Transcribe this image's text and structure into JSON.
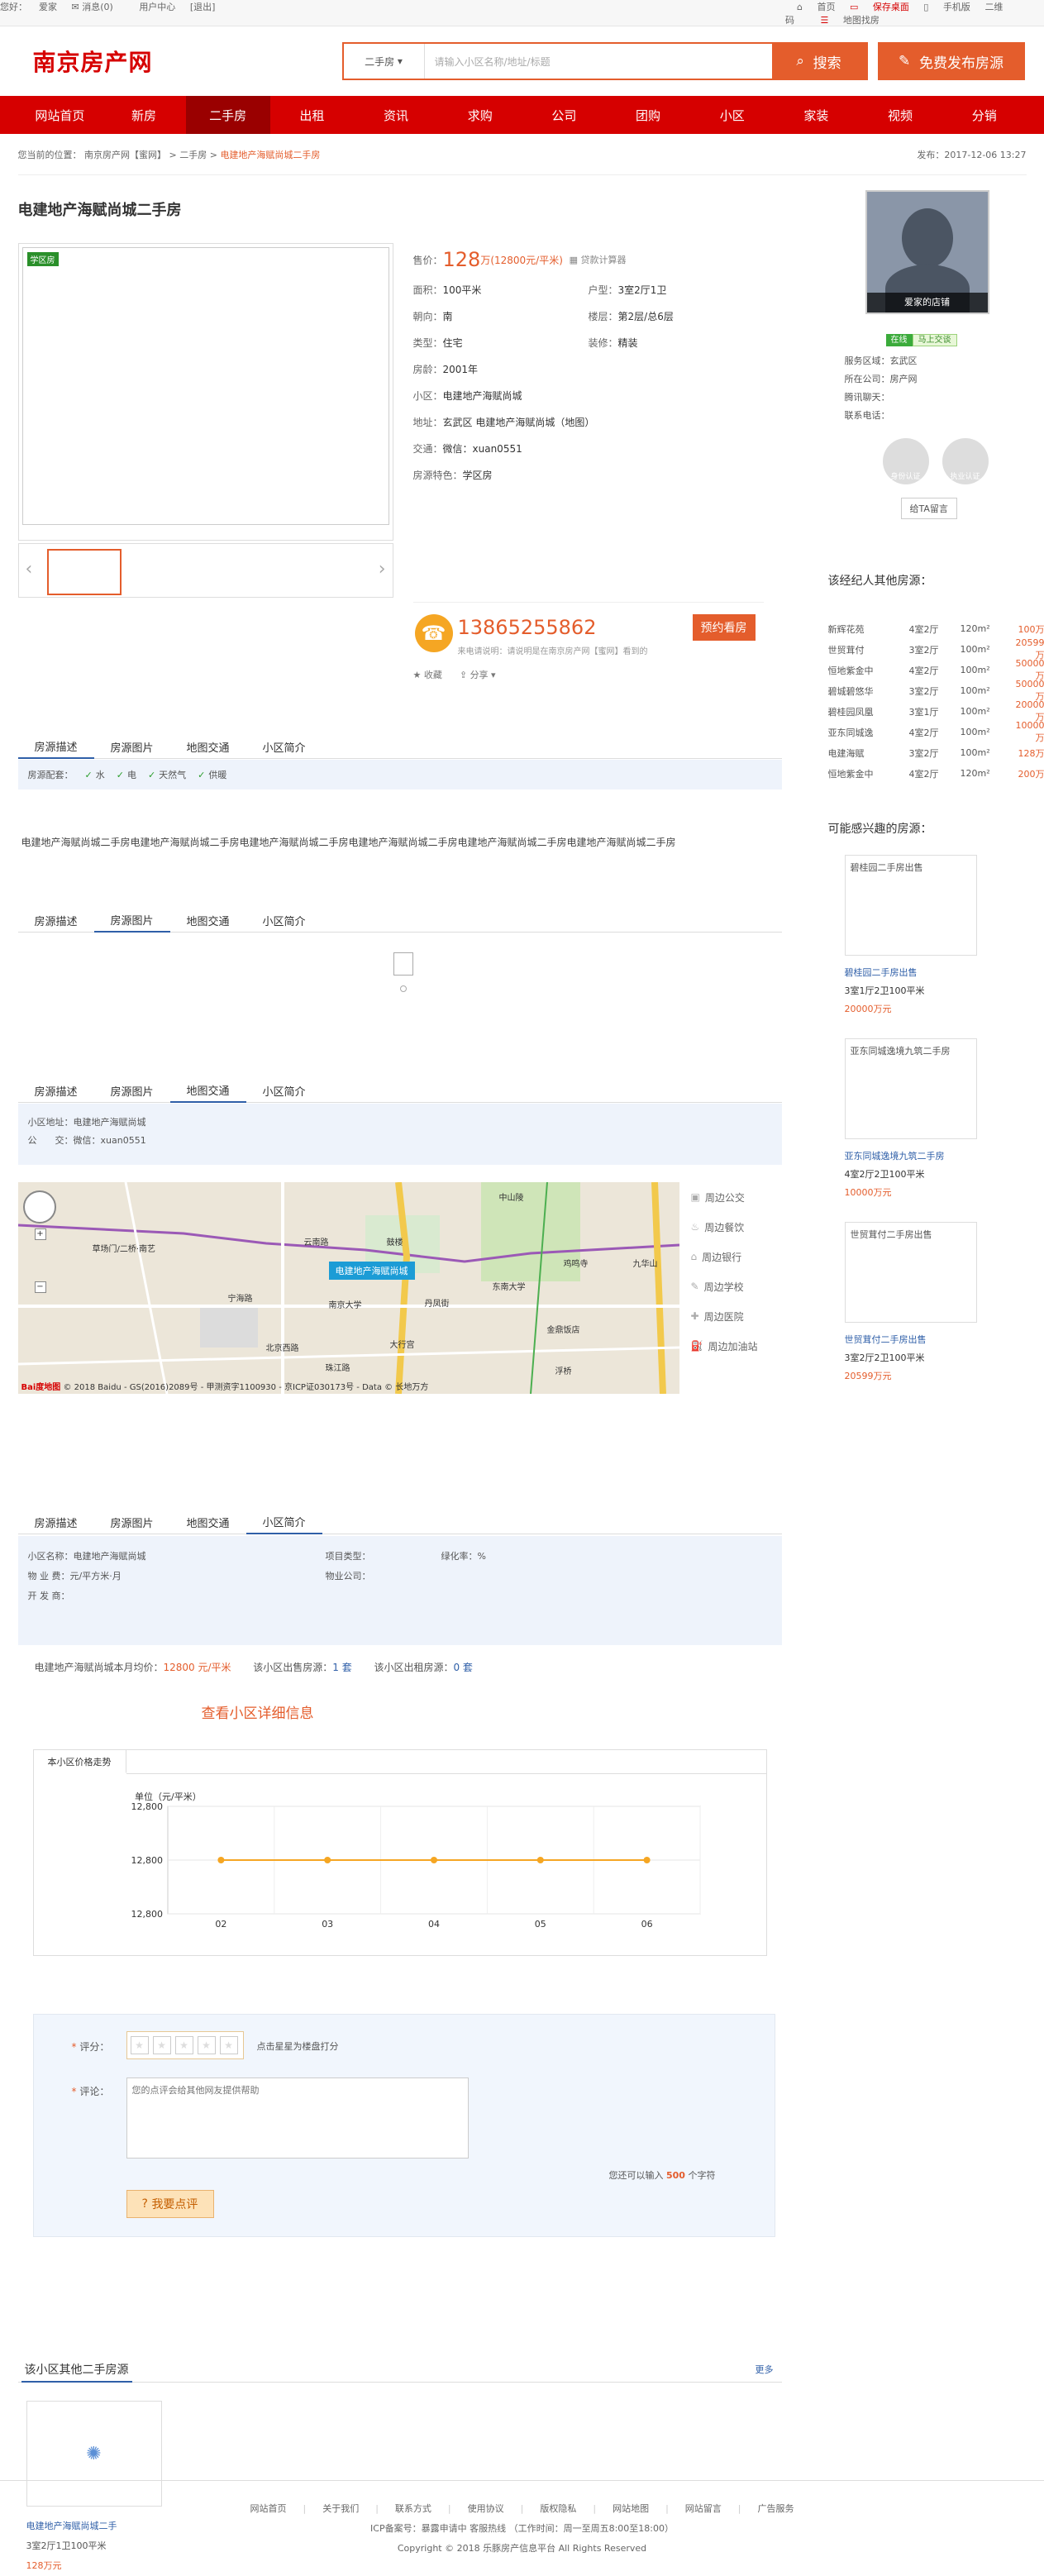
{
  "topbar": {
    "greeting": "您好：",
    "user": "爱家",
    "messages": "消息(0)",
    "user_center": "用户中心",
    "logout": "[退出]",
    "home": "首页",
    "save_desktop": "保存桌面",
    "mobile": "手机版",
    "qrcode": "二维码",
    "map_find": "地图找房"
  },
  "header": {
    "logo": "南京房产网",
    "search_select": "二手房",
    "search_placeholder": "请输入小区名称/地址/标题",
    "search_btn": "搜索",
    "publish_btn": "免费发布房源"
  },
  "nav": [
    "网站首页",
    "新房",
    "二手房",
    "出租",
    "资讯",
    "求购",
    "公司",
    "团购",
    "小区",
    "家装",
    "视频",
    "分销"
  ],
  "nav_active": 2,
  "crumb": {
    "prefix": "您当前的位置：",
    "site": "南京房产网【蜜网】",
    "sec": "二手房",
    "cur": "电建地产海赋尚城二手房",
    "date": "发布：2017-12-06 13:27"
  },
  "listing": {
    "title": "电建地产海赋尚城二手房",
    "tag": "学区房",
    "price_label": "售价：",
    "price": "128",
    "price_unit": "万(12800元/平米)",
    "calc": "贷款计算器",
    "area_k": "面积：",
    "area": "100平米",
    "type_k": "户型：",
    "type": "3室2厅1卫",
    "orient_k": "朝向：",
    "orient": "南",
    "floor_k": "楼层：",
    "floor": "第2层/总6层",
    "kind_k": "类型：",
    "kind": "住宅",
    "decor_k": "装修：",
    "decor": "精装",
    "age_k": "房龄：",
    "age": "2001年",
    "comm_k": "小区：",
    "comm": "电建地产海赋尚城",
    "addr_k": "地址：",
    "addr": "玄武区 电建地产海赋尚城（地图）",
    "traffic_k": "交通：",
    "traffic": "微信：xuan0551",
    "feat_k": "房源特色：",
    "feat": "学区房",
    "phone": "13865255862",
    "book": "预约看房",
    "phone_note": "来电请说明：请说明是在南京房产网【蜜网】看到的",
    "fav": "收藏",
    "share": "分享"
  },
  "tabs": [
    "房源描述",
    "房源图片",
    "地图交通",
    "小区简介"
  ],
  "features": {
    "label": "房源配套：",
    "items": [
      "水",
      "电",
      "天然气",
      "供暖"
    ]
  },
  "desc_text": "电建地产海赋尚城二手房电建地产海赋尚城二手房电建地产海赋尚城二手房电建地产海赋尚城二手房电建地产海赋尚城二手房电建地产海赋尚城二手房",
  "map_info": {
    "addr": "小区地址：电建地产海赋尚城",
    "traffic": "公　　交：微信：xuan0551"
  },
  "map": {
    "labels": [
      "南京大学",
      "珠江路",
      "鼓楼",
      "云南路",
      "鸡鸣寺",
      "九华山",
      "东南大学",
      "丹凤街",
      "宁海路",
      "草场门/二桥·南艺",
      "浮桥",
      "金鼎饭店",
      "中山陵",
      "北京西路",
      "大行宫"
    ],
    "pin": "电建地产海赋尚城",
    "copyright": "© 2018 Baidu - GS(2016)2089号 - 甲测资字1100930 - 京ICP证030173号 - Data © 长地万方",
    "baidu": "Bai度地图"
  },
  "map_tools": [
    "周边公交",
    "周边餐饮",
    "周边银行",
    "周边学校",
    "周边医院",
    "周边加油站"
  ],
  "community": {
    "name_k": "小区名称：",
    "name": "电建地产海赋尚城",
    "type_k": "项目类型：",
    "type": "",
    "green_k": "绿化率：",
    "green": "%",
    "fee_k": "物 业 费：",
    "fee": "元/平方米·月",
    "company_k": "物业公司：",
    "company": "",
    "dev_k": "开 发 商：",
    "dev": ""
  },
  "avg": {
    "t1": "电建地产海赋尚城本月均价：",
    "v1": "12800 元/平米",
    "t2": "该小区出售房源：",
    "v2": "1 套",
    "t3": "该小区出租房源：",
    "v3": "0 套"
  },
  "more_info": "查看小区详细信息",
  "chart_title": "本小区价格走势",
  "chart_data": {
    "type": "line",
    "title": "",
    "ylabel": "单位（元/平米）",
    "x": [
      "02",
      "03",
      "04",
      "05",
      "06"
    ],
    "series": [
      {
        "name": "",
        "values": [
          12800,
          12800,
          12800,
          12800,
          12800
        ]
      }
    ],
    "yticks": [
      "12,800",
      "12,800",
      "12,800"
    ],
    "ylim": [
      12799,
      12801
    ],
    "grid": true
  },
  "review": {
    "score_label": "评分：",
    "score_hint": "点击星星为楼盘打分",
    "comment_label": "评论：",
    "placeholder": "您的点评会给其他网友提供帮助",
    "count_text": "您还可以输入",
    "count": "500",
    "count_suffix": "个字符",
    "submit": "我要点评"
  },
  "other": {
    "title": "该小区其他二手房源",
    "more": "更多",
    "name": "电建地产海赋尚城二手",
    "spec": "3室2厅1卫100平米",
    "price": "128万元"
  },
  "agent": {
    "name": "爱家的店铺",
    "online": "在线",
    "talk": "马上交谈",
    "area": "服务区域：玄武区",
    "company": "所在公司：房产网",
    "qq": "腾讯聊天：",
    "tel": "联系电话：",
    "v1": "身份认证",
    "v2": "执业认证",
    "msg": "给TA留言"
  },
  "agent_other_title": "该经纪人其他房源：",
  "agent_other": [
    [
      "新辉花苑",
      "4室2厅",
      "120m²",
      "100万"
    ],
    [
      "世贸茸付",
      "3室2厅",
      "100m²",
      "20599万"
    ],
    [
      "恒地紫金中",
      "4室2厅",
      "100m²",
      "50000万"
    ],
    [
      "碧城碧悠华",
      "3室2厅",
      "100m²",
      "50000万"
    ],
    [
      "碧桂园凤凰",
      "3室1厅",
      "100m²",
      "20000万"
    ],
    [
      "亚东同城逸",
      "4室2厅",
      "100m²",
      "10000万"
    ],
    [
      "电建海赋",
      "3室2厅",
      "100m²",
      "128万"
    ],
    [
      "恒地紫金中",
      "4室2厅",
      "120m²",
      "200万"
    ]
  ],
  "interest_title": "可能感兴趣的房源：",
  "interest": [
    {
      "img": "碧桂园二手房出售",
      "name": "碧桂园二手房出售",
      "spec": "3室1厅2卫100平米",
      "price": "20000万元"
    },
    {
      "img": "亚东同城逸境九筑二手房",
      "name": "亚东同城逸境九筑二手房",
      "spec": "4室2厅2卫100平米",
      "price": "10000万元"
    },
    {
      "img": "世贸茸付二手房出售",
      "name": "世贸茸付二手房出售",
      "spec": "3室2厅2卫100平米",
      "price": "20599万元"
    }
  ],
  "footer": {
    "links": [
      "网站首页",
      "关于我们",
      "联系方式",
      "使用协议",
      "版权隐私",
      "网站地图",
      "网站留言",
      "广告服务"
    ],
    "icp": "ICP备案号：暴露申请中 客服热线 （工作时间：周一至周五8:00至18:00）",
    "copy": "Copyright © 2018 乐豚房产信息平台 All Rights Reserved"
  },
  "colors": {
    "brand": "#d60000",
    "accent": "#e45d2c",
    "link": "#2f5fa8"
  }
}
